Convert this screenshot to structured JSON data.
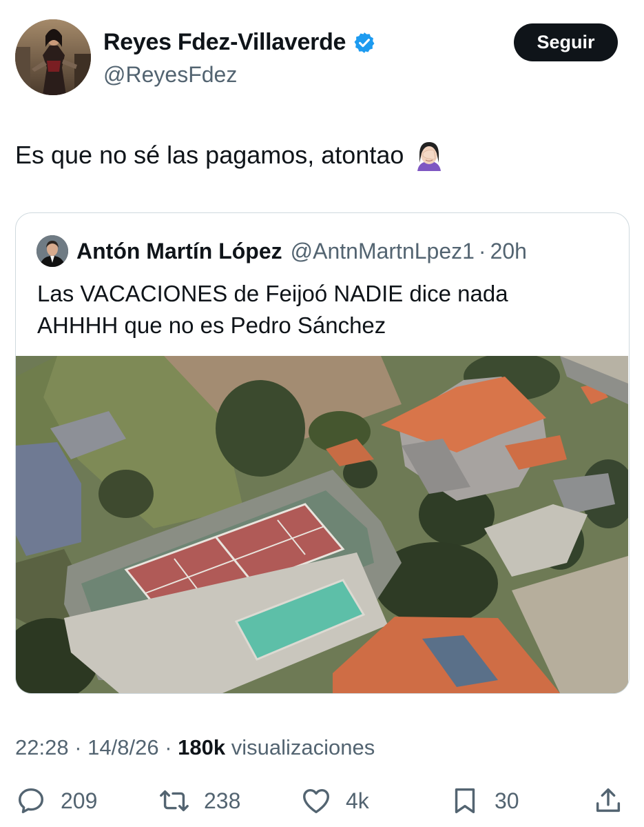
{
  "author": {
    "name": "Reyes Fdez-Villaverde",
    "handle": "@ReyesFdez",
    "verified_icon": "verified-badge-icon",
    "follow_label": "Seguir"
  },
  "tweet": {
    "text": "Es que no sé las pagamos, atontao",
    "emoji_icon": "woman-facepalming-emoji"
  },
  "quoted": {
    "name": "Antón Martín López",
    "handle": "@AntnMartnLpez1",
    "separator": "·",
    "time": "20h",
    "text_lines": [
      "Las VACACIONES de Feijoó NADIE dice nada",
      "AHHHH que no es Pedro Sánchez"
    ],
    "image_icon": "aerial-photo-house-tennis-court-pool"
  },
  "meta": {
    "time": "22:28",
    "sep": "·",
    "date": "14/8/26",
    "views_count": "180k",
    "views_label": "visualizaciones"
  },
  "actions": {
    "replies": "209",
    "retweets": "238",
    "likes": "4k",
    "bookmarks": "30"
  },
  "colors": {
    "text": "#0f1419",
    "secondary": "#536471",
    "verified": "#1d9bf0",
    "border": "#cfd9de",
    "follow_bg": "#0f1419"
  }
}
